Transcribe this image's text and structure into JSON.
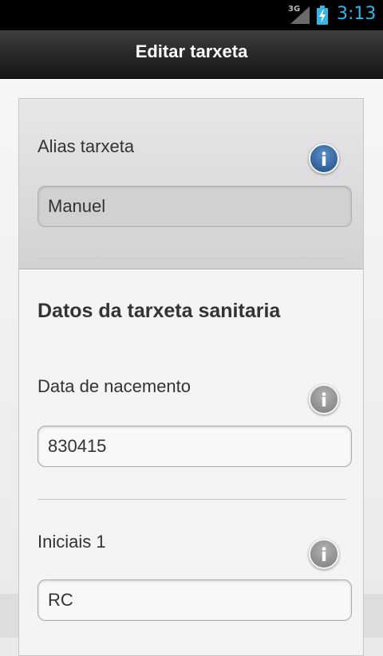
{
  "status_bar": {
    "network": "3G",
    "time": "3:13",
    "icons": [
      "signal-icon",
      "battery-charging-icon"
    ]
  },
  "app_bar": {
    "title": "Editar tarxeta"
  },
  "alias": {
    "label": "Alias tarxeta",
    "value": "Manuel",
    "info_icon": "info-icon"
  },
  "section": {
    "title": "Datos da tarxeta sanitaria"
  },
  "fields": {
    "birth_date": {
      "label": "Data de nacemento",
      "value": "830415",
      "info_icon": "info-icon"
    },
    "initials1": {
      "label": "Iniciais 1",
      "value": "RC",
      "info_icon": "info-icon"
    }
  },
  "colors": {
    "accent_time": "#33b5e5",
    "info_blue": "#2a5a96",
    "info_gray": "#8a888a"
  }
}
